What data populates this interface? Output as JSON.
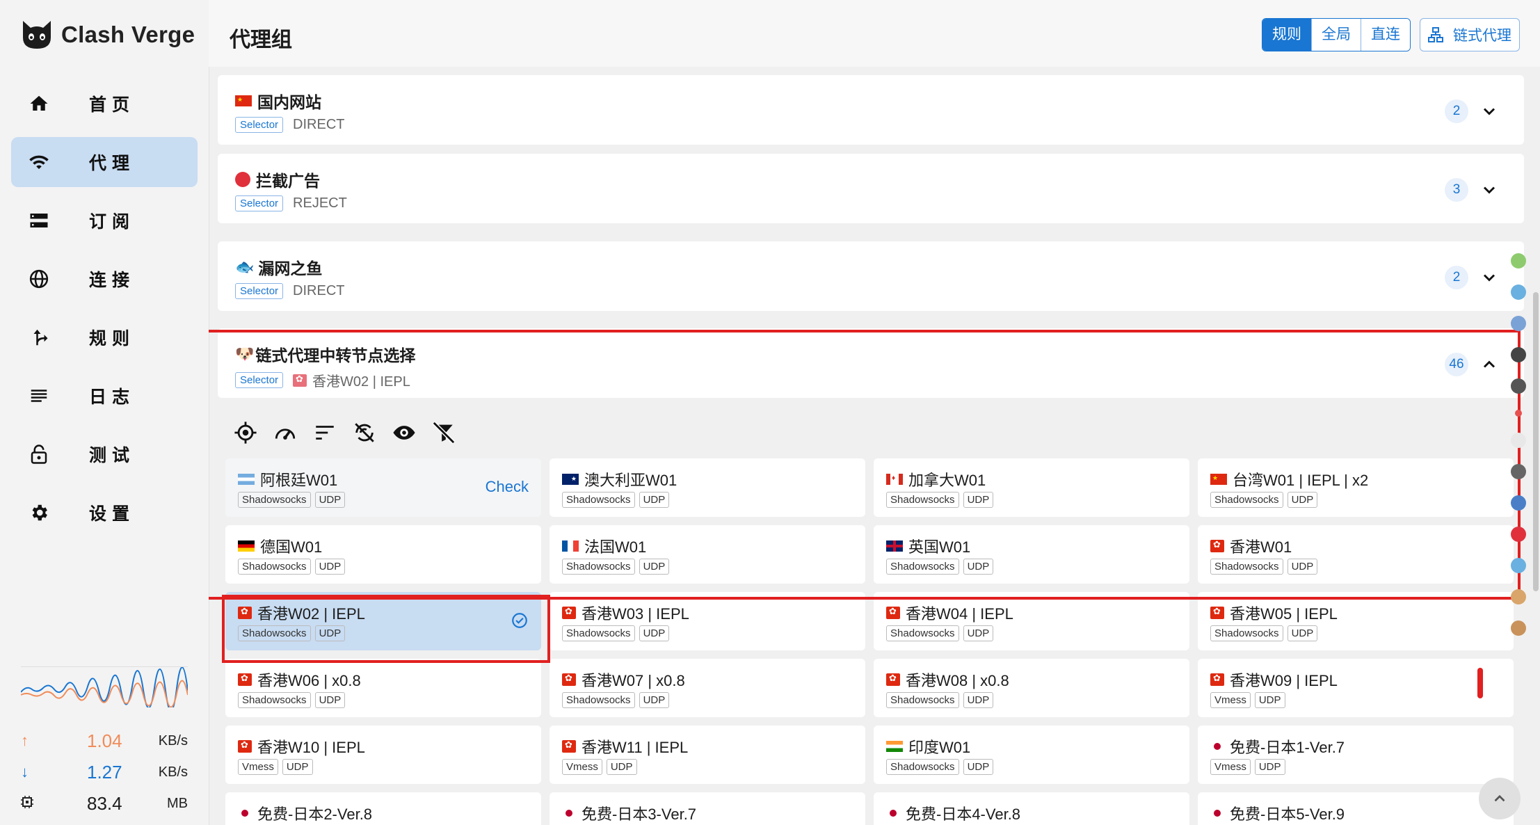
{
  "app": {
    "title": "Clash Verge"
  },
  "nav": [
    {
      "label": "首页",
      "icon": "home-icon",
      "active": false
    },
    {
      "label": "代理",
      "icon": "wifi-icon",
      "active": true
    },
    {
      "label": "订阅",
      "icon": "storage-icon",
      "active": false
    },
    {
      "label": "连接",
      "icon": "globe-icon",
      "active": false
    },
    {
      "label": "规则",
      "icon": "fork-icon",
      "active": false
    },
    {
      "label": "日志",
      "icon": "list-icon",
      "active": false
    },
    {
      "label": "测试",
      "icon": "lock-icon",
      "active": false
    },
    {
      "label": "设置",
      "icon": "gear-icon",
      "active": false
    }
  ],
  "traffic": {
    "upload_value": "1.04",
    "upload_unit": "KB/s",
    "download_value": "1.27",
    "download_unit": "KB/s",
    "memory_value": "83.4",
    "memory_unit": "MB"
  },
  "header": {
    "title": "代理组",
    "modes": [
      "规则",
      "全局",
      "直连"
    ],
    "active_mode": "规则",
    "chain_label": "链式代理"
  },
  "groups": [
    {
      "emoji": "🇨🇳",
      "name": "国内网站",
      "type": "Selector",
      "now": "DIRECT",
      "count": "2",
      "expanded": false
    },
    {
      "emoji": "🛑",
      "name": "拦截广告",
      "type": "Selector",
      "now": "REJECT",
      "count": "3",
      "expanded": false
    },
    {
      "emoji": "🐟",
      "name": "漏网之鱼",
      "type": "Selector",
      "now": "DIRECT",
      "count": "2",
      "expanded": false
    },
    {
      "emoji": "🐶",
      "name": "链式代理中转节点选择",
      "type": "Selector",
      "now": "香港W02 | IEPL",
      "count": "46",
      "expanded": true
    }
  ],
  "toolbar_icons": [
    "locate-icon",
    "speed-test-icon",
    "sort-icon",
    "filter-off-icon",
    "eye-icon",
    "funnel-off-icon"
  ],
  "check_label": "Check",
  "proxies": [
    {
      "flag": "ar",
      "name": "阿根廷W01",
      "tags": [
        "Shadowsocks",
        "UDP"
      ]
    },
    {
      "flag": "au",
      "name": "澳大利亚W01",
      "tags": [
        "Shadowsocks",
        "UDP"
      ]
    },
    {
      "flag": "ca",
      "name": "加拿大W01",
      "tags": [
        "Shadowsocks",
        "UDP"
      ]
    },
    {
      "flag": "tw",
      "name": "台湾W01 | IEPL | x2",
      "tags": [
        "Shadowsocks",
        "UDP"
      ]
    },
    {
      "flag": "de",
      "name": "德国W01",
      "tags": [
        "Shadowsocks",
        "UDP"
      ]
    },
    {
      "flag": "fr",
      "name": "法国W01",
      "tags": [
        "Shadowsocks",
        "UDP"
      ]
    },
    {
      "flag": "gb",
      "name": "英国W01",
      "tags": [
        "Shadowsocks",
        "UDP"
      ]
    },
    {
      "flag": "hk",
      "name": "香港W01",
      "tags": [
        "Shadowsocks",
        "UDP"
      ]
    },
    {
      "flag": "hk",
      "name": "香港W02 | IEPL",
      "tags": [
        "Shadowsocks",
        "UDP"
      ],
      "selected": true
    },
    {
      "flag": "hk",
      "name": "香港W03 | IEPL",
      "tags": [
        "Shadowsocks",
        "UDP"
      ]
    },
    {
      "flag": "hk",
      "name": "香港W04 | IEPL",
      "tags": [
        "Shadowsocks",
        "UDP"
      ]
    },
    {
      "flag": "hk",
      "name": "香港W05 | IEPL",
      "tags": [
        "Shadowsocks",
        "UDP"
      ]
    },
    {
      "flag": "hk",
      "name": "香港W06 | x0.8",
      "tags": [
        "Shadowsocks",
        "UDP"
      ]
    },
    {
      "flag": "hk",
      "name": "香港W07 | x0.8",
      "tags": [
        "Shadowsocks",
        "UDP"
      ]
    },
    {
      "flag": "hk",
      "name": "香港W08 | x0.8",
      "tags": [
        "Shadowsocks",
        "UDP"
      ]
    },
    {
      "flag": "hk",
      "name": "香港W09 | IEPL",
      "tags": [
        "Vmess",
        "UDP"
      ]
    },
    {
      "flag": "hk",
      "name": "香港W10 | IEPL",
      "tags": [
        "Vmess",
        "UDP"
      ]
    },
    {
      "flag": "hk",
      "name": "香港W11 | IEPL",
      "tags": [
        "Vmess",
        "UDP"
      ]
    },
    {
      "flag": "in",
      "name": "印度W01",
      "tags": [
        "Shadowsocks",
        "UDP"
      ]
    },
    {
      "flag": "jp",
      "name": "免费-日本1-Ver.7",
      "tags": [
        "Vmess",
        "UDP"
      ]
    },
    {
      "flag": "jp",
      "name": "免费-日本2-Ver.8",
      "tags": []
    },
    {
      "flag": "jp",
      "name": "免费-日本3-Ver.7",
      "tags": []
    },
    {
      "flag": "jp",
      "name": "免费-日本4-Ver.8",
      "tags": []
    },
    {
      "flag": "jp",
      "name": "免费-日本5-Ver.9",
      "tags": []
    }
  ],
  "colors": {
    "accent": "#1976d2",
    "selected_bg": "#c8dcf2",
    "highlight_box": "#e12020",
    "upload": "#f08c5a",
    "download": "#1976d2"
  }
}
